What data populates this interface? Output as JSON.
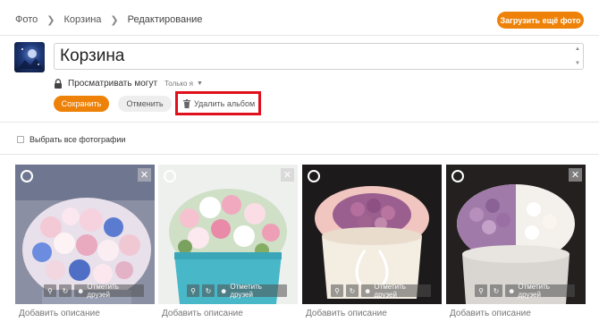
{
  "breadcrumbs": [
    {
      "label": "Фото"
    },
    {
      "label": "Корзина"
    },
    {
      "label": "Редактирование"
    }
  ],
  "header": {
    "upload_label": "Загрузить ещё фото"
  },
  "album": {
    "title": "Корзина",
    "privacy_label": "Просматривать могут",
    "privacy_value": "Только я"
  },
  "actions": {
    "save": "Сохранить",
    "cancel": "Отменить",
    "delete": "Удалить альбом"
  },
  "select_all_label": "Выбрать все фотографии",
  "photos": [
    {
      "tag_label": "Отметить друзей",
      "description_placeholder": "Добавить описание"
    },
    {
      "tag_label": "Отметить друзей",
      "description_placeholder": "Добавить описание"
    },
    {
      "tag_label": "Отметить друзей",
      "description_placeholder": "Добавить описание"
    },
    {
      "tag_label": "Отметить друзей",
      "description_placeholder": "Добавить описание"
    }
  ],
  "colors": {
    "accent": "#ee8208",
    "highlight": "#e0101d"
  },
  "icons": [
    "chevron-right-icon",
    "lock-icon",
    "caret-down-icon",
    "trash-icon",
    "close-icon",
    "zoom-icon",
    "rotate-icon",
    "tag-user-icon"
  ]
}
